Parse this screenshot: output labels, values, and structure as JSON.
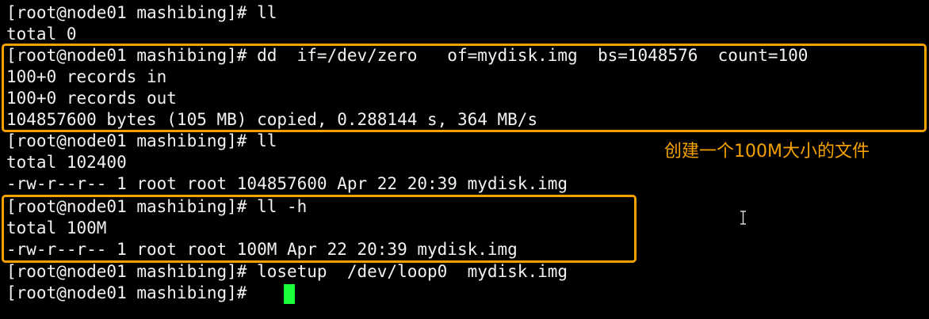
{
  "terminal": {
    "lines": [
      "[root@node01 mashibing]# ll",
      "total 0",
      "[root@node01 mashibing]# dd  if=/dev/zero   of=mydisk.img  bs=1048576  count=100",
      "100+0 records in",
      "100+0 records out",
      "104857600 bytes (105 MB) copied, 0.288144 s, 364 MB/s",
      "[root@node01 mashibing]# ll",
      "total 102400",
      "-rw-r--r-- 1 root root 104857600 Apr 22 20:39 mydisk.img",
      "[root@node01 mashibing]# ll -h",
      "total 100M",
      "-rw-r--r-- 1 root root 100M Apr 22 20:39 mydisk.img",
      "[root@node01 mashibing]# losetup  /dev/loop0  mydisk.img",
      "[root@node01 mashibing]# "
    ],
    "annotation": "创建一个100M大小的文件",
    "colors": {
      "background": "#000000",
      "text": "#f2f2f2",
      "highlight": "#f5a100",
      "cursor": "#1aff3a"
    }
  }
}
